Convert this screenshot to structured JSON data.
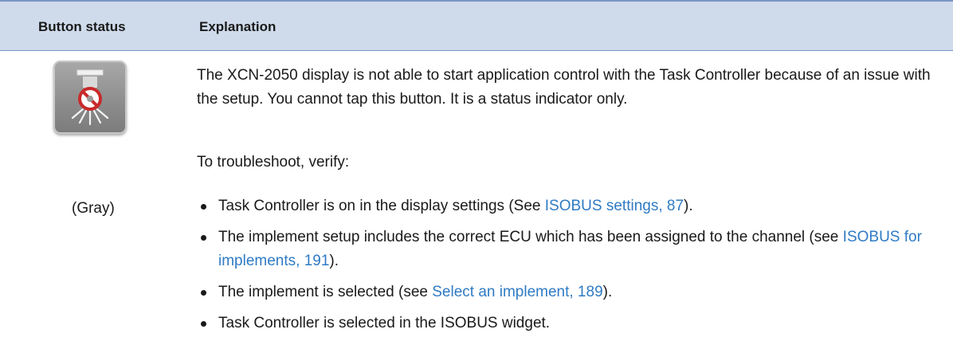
{
  "header": {
    "col1": "Button status",
    "col2": "Explanation"
  },
  "row": {
    "button_icon": "task-controller-disabled-icon",
    "button_label": "(Gray)",
    "paragraph1": "The XCN-2050 display is not able to start application control with the Task Controller because of an issue with the setup. You cannot tap this button. It is a status indicator only.",
    "paragraph2": "To troubleshoot, verify:",
    "bullets": [
      {
        "pre": "Task Controller is on in the display settings (See ",
        "link": "ISOBUS settings, 87",
        "post": ")."
      },
      {
        "pre": "The implement setup includes the correct ECU which has been assigned to the channel (see ",
        "link": "ISOBUS for implements, 191",
        "post": ")."
      },
      {
        "pre": "The implement is selected (see ",
        "link": "Select an implement, 189",
        "post": ")."
      },
      {
        "pre": "Task Controller is selected in the ISOBUS widget.",
        "link": "",
        "post": ""
      }
    ]
  },
  "colors": {
    "header_bg": "#cfdbeb",
    "rule": "#7a96c4",
    "link": "#2f7bc4",
    "prohibit_red": "#c92a2a"
  }
}
